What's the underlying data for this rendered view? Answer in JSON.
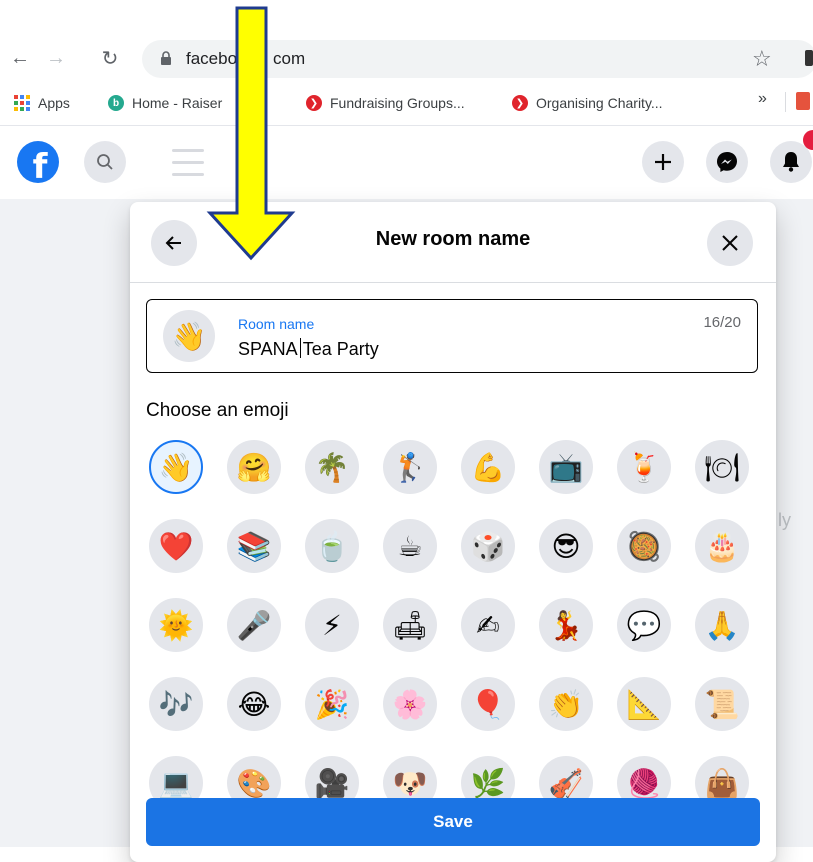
{
  "browser": {
    "url": "facebook.com",
    "url_visible": "facebo",
    "url_visible_tail": "com",
    "bookmarks": [
      {
        "label": "Apps",
        "icon": "apps-grid-icon"
      },
      {
        "label": "Home - Raiser",
        "icon": "b-icon"
      },
      {
        "label": "Fundraising Groups...",
        "icon": "red-chevron-icon"
      },
      {
        "label": "Organising Charity...",
        "icon": "red-chevron-icon"
      }
    ],
    "more": "»"
  },
  "fb_header": {
    "logo": "f"
  },
  "modal": {
    "title": "New room name",
    "field_label": "Room name",
    "field_value_before_caret": "SPANA",
    "field_value_after_caret": "Tea Party",
    "counter": "16/20",
    "selected_emoji": "👋",
    "choose_label": "Choose an emoji",
    "save_label": "Save",
    "emojis": [
      "👋",
      "🤗",
      "🌴",
      "🏌",
      "💪",
      "📺",
      "🍹",
      "🍽",
      "❤️",
      "📚",
      "🍵",
      "☕",
      "🎲",
      "😎",
      "🥘",
      "🎂",
      "🌞",
      "🎤",
      "⚡",
      "🛋",
      "✍",
      "💃",
      "💬",
      "🙏",
      "🎶",
      "😂",
      "🎉",
      "🌸",
      "🎈",
      "👏",
      "📐",
      "📜",
      "💻",
      "🎨",
      "🎥",
      "🐶",
      "🌿",
      "🎻",
      "🧶",
      "👜"
    ]
  },
  "colors": {
    "fb_blue": "#1877f2",
    "save_blue": "#1b74e4",
    "arrow_yellow": "#ffff00",
    "arrow_outline": "#1f3b8f"
  }
}
